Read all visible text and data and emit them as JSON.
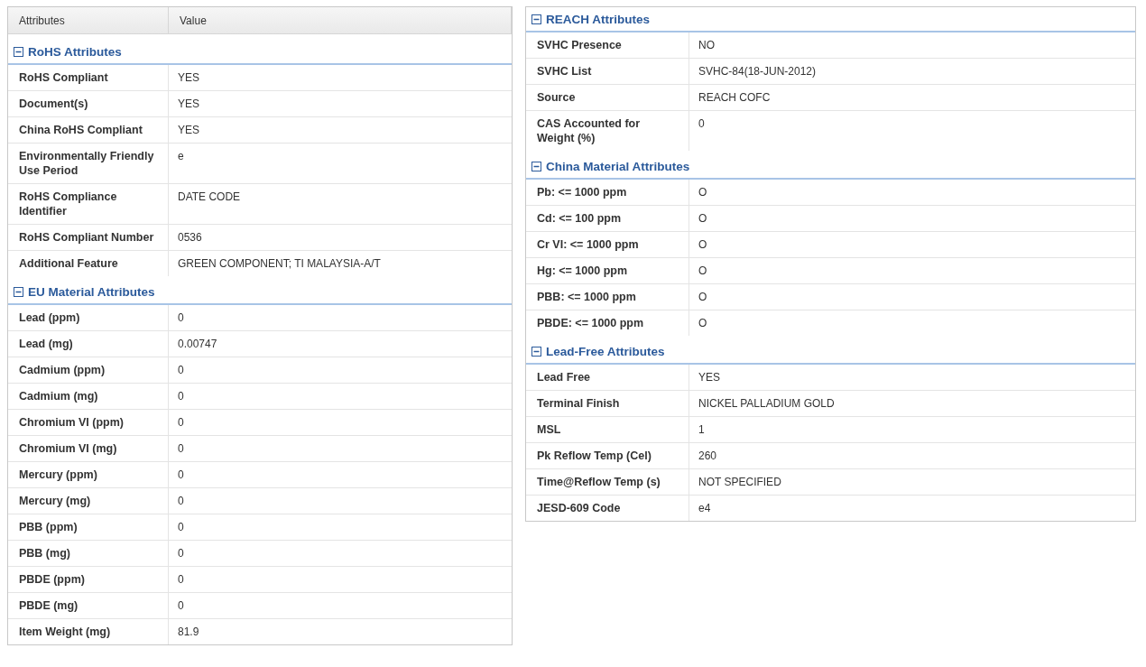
{
  "left_panel": {
    "columns": [
      "Attributes",
      "Value"
    ],
    "sections": [
      {
        "title": "RoHS Attributes",
        "expanded": true,
        "rows": [
          {
            "attribute": "RoHS Compliant",
            "value": "YES"
          },
          {
            "attribute": "Document(s)",
            "value": "YES"
          },
          {
            "attribute": "China RoHS Compliant",
            "value": "YES"
          },
          {
            "attribute": "Environmentally Friendly Use Period",
            "value": "e"
          },
          {
            "attribute": "RoHS Compliance Identifier",
            "value": "DATE CODE"
          },
          {
            "attribute": "RoHS Compliant Number",
            "value": "0536"
          },
          {
            "attribute": "Additional Feature",
            "value": "GREEN COMPONENT; TI MALAYSIA-A/T"
          }
        ]
      },
      {
        "title": "EU Material Attributes",
        "expanded": true,
        "rows": [
          {
            "attribute": "Lead (ppm)",
            "value": "0"
          },
          {
            "attribute": "Lead (mg)",
            "value": "0.00747"
          },
          {
            "attribute": "Cadmium (ppm)",
            "value": "0"
          },
          {
            "attribute": "Cadmium (mg)",
            "value": "0"
          },
          {
            "attribute": "Chromium VI (ppm)",
            "value": "0"
          },
          {
            "attribute": "Chromium VI (mg)",
            "value": "0"
          },
          {
            "attribute": "Mercury (ppm)",
            "value": "0"
          },
          {
            "attribute": "Mercury (mg)",
            "value": "0"
          },
          {
            "attribute": "PBB (ppm)",
            "value": "0"
          },
          {
            "attribute": "PBB (mg)",
            "value": "0"
          },
          {
            "attribute": "PBDE (ppm)",
            "value": "0"
          },
          {
            "attribute": "PBDE (mg)",
            "value": "0"
          },
          {
            "attribute": "Item Weight (mg)",
            "value": "81.9"
          }
        ]
      }
    ]
  },
  "right_panel": {
    "sections": [
      {
        "title": "REACH Attributes",
        "expanded": true,
        "rows": [
          {
            "attribute": "SVHC Presence",
            "value": "NO"
          },
          {
            "attribute": "SVHC List",
            "value": "SVHC-84(18-JUN-2012)"
          },
          {
            "attribute": "Source",
            "value": "REACH COFC"
          },
          {
            "attribute": "CAS Accounted for Weight (%)",
            "value": "0"
          }
        ]
      },
      {
        "title": "China Material Attributes",
        "expanded": true,
        "rows": [
          {
            "attribute": "Pb: <= 1000 ppm",
            "value": "O"
          },
          {
            "attribute": "Cd: <= 100 ppm",
            "value": "O"
          },
          {
            "attribute": "Cr VI: <= 1000 ppm",
            "value": "O"
          },
          {
            "attribute": "Hg: <= 1000 ppm",
            "value": "O"
          },
          {
            "attribute": "PBB: <= 1000 ppm",
            "value": "O"
          },
          {
            "attribute": "PBDE: <= 1000 ppm",
            "value": "O"
          }
        ]
      },
      {
        "title": "Lead-Free Attributes",
        "expanded": true,
        "rows": [
          {
            "attribute": "Lead Free",
            "value": "YES"
          },
          {
            "attribute": "Terminal Finish",
            "value": "NICKEL PALLADIUM GOLD"
          },
          {
            "attribute": "MSL",
            "value": "1"
          },
          {
            "attribute": "Pk Reflow Temp (Cel)",
            "value": "260"
          },
          {
            "attribute": "Time@Reflow Temp (s)",
            "value": "NOT SPECIFIED"
          },
          {
            "attribute": "JESD-609 Code",
            "value": "e4"
          }
        ]
      }
    ]
  }
}
